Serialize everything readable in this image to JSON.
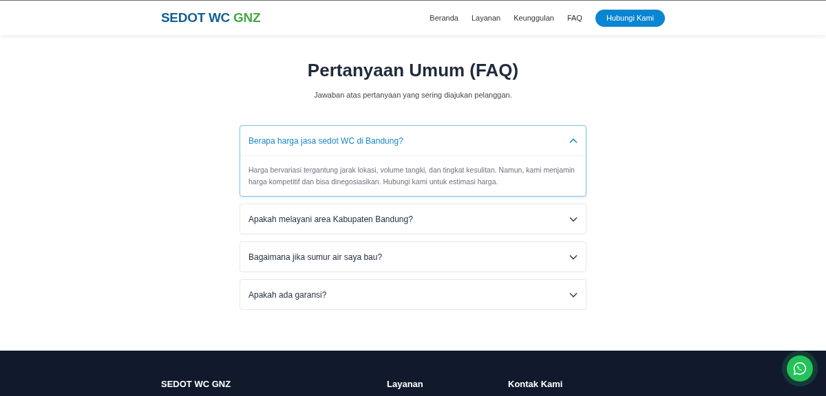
{
  "header": {
    "brand": {
      "primary": "SEDOT WC",
      "accent": "GNZ"
    },
    "nav": [
      {
        "label": "Beranda"
      },
      {
        "label": "Layanan"
      },
      {
        "label": "Keunggulan"
      },
      {
        "label": "FAQ"
      }
    ],
    "cta": "Hubungi Kami"
  },
  "faq": {
    "title": "Pertanyaan Umum (FAQ)",
    "subtitle": "Jawaban atas pertanyaan yang sering diajukan pelanggan.",
    "items": [
      {
        "question": "Berapa harga jasa sedot WC di Bandung?",
        "expanded": true,
        "answer": "Harga bervariasi tergantung jarak lokasi, volume tangki, dan tingkat kesulitan. Namun, kami menjamin harga kompetitif dan bisa dinegosiasikan. Hubungi kami untuk estimasi harga."
      },
      {
        "question": "Apakah melayani area Kabupaten Bandung?",
        "expanded": false
      },
      {
        "question": "Bagaimana jika sumur air saya bau?",
        "expanded": false
      },
      {
        "question": "Apakah ada garansi?",
        "expanded": false
      }
    ]
  },
  "footer": {
    "columns": [
      {
        "heading": "SEDOT WC GNZ"
      },
      {
        "heading": "Layanan"
      },
      {
        "heading": "Kontak Kami"
      }
    ]
  }
}
